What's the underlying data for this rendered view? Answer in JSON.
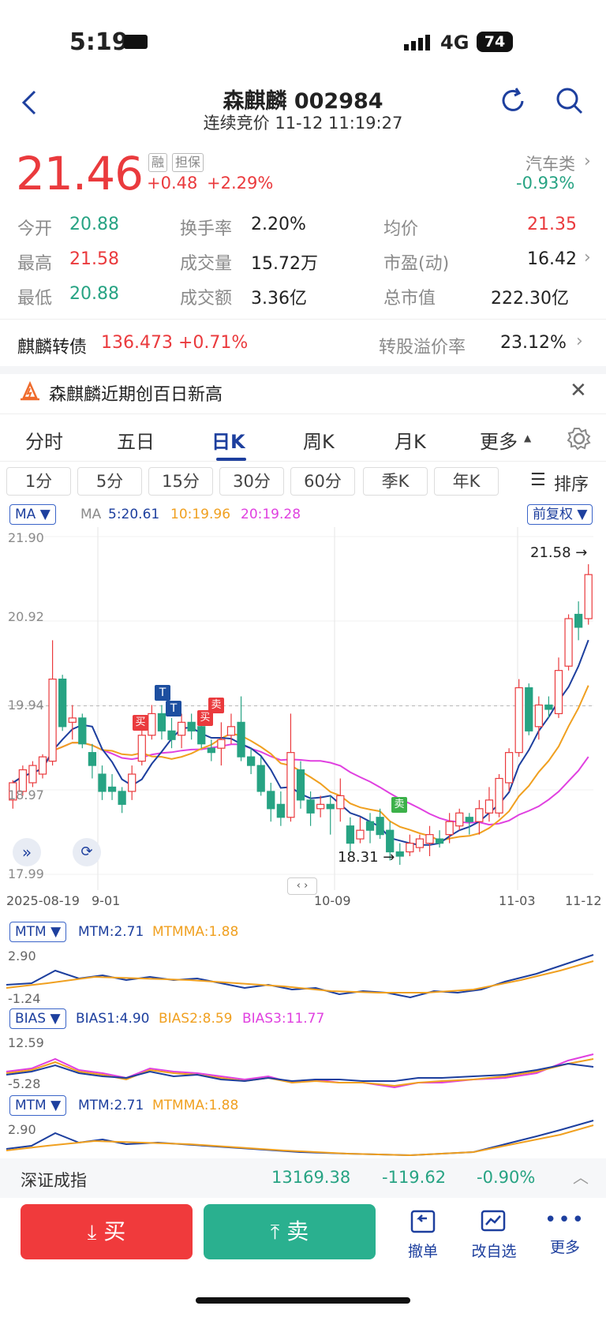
{
  "status": {
    "time": "5:19",
    "network": "4G",
    "battery": "74"
  },
  "header": {
    "title": "森麒麟 002984",
    "subtitle": "连续竞价 11-12 11:19:27"
  },
  "quote": {
    "price": "21.46",
    "tag1": "融",
    "tag2": "担保",
    "change": "+0.48",
    "change_pct": "+2.29%",
    "sector": "汽车类",
    "sector_pct": "-0.93%"
  },
  "stats": [
    [
      {
        "label": "今开",
        "value": "20.88",
        "color": "green"
      },
      {
        "label": "换手率",
        "value": "2.20%",
        "color": "dark"
      },
      {
        "label": "均价",
        "value": "21.35",
        "color": "red"
      }
    ],
    [
      {
        "label": "最高",
        "value": "21.58",
        "color": "red"
      },
      {
        "label": "成交量",
        "value": "15.72万",
        "color": "dark"
      },
      {
        "label": "市盈(动)",
        "value": "16.42",
        "color": "dark"
      }
    ],
    [
      {
        "label": "最低",
        "value": "20.88",
        "color": "green"
      },
      {
        "label": "成交额",
        "value": "3.36亿",
        "color": "dark"
      },
      {
        "label": "总市值",
        "value": "222.30亿",
        "color": "dark"
      }
    ]
  ],
  "bond": {
    "name": "麒麟转债",
    "value": "136.473 +0.71%",
    "premium_label": "转股溢价率",
    "premium": "23.12%"
  },
  "notice": {
    "text": "森麒麟近期创百日新高"
  },
  "tabs": [
    "分时",
    "五日",
    "日K",
    "周K",
    "月K",
    "更多"
  ],
  "active_tab": "日K",
  "periods": [
    "1分",
    "5分",
    "15分",
    "30分",
    "60分",
    "季K",
    "年K"
  ],
  "sort_label": "排序",
  "ma": {
    "chip": "MA",
    "label": "MA",
    "ma5": "5:20.61",
    "ma10": "10:19.96",
    "ma20": "20:19.28",
    "adjust": "前复权"
  },
  "price_axis": [
    "21.90",
    "20.92",
    "19.94",
    "18.97",
    "17.99"
  ],
  "date_axis": [
    "2025-08-19",
    "9-01",
    "10-09",
    "11-03",
    "11-12"
  ],
  "markers": {
    "high": "21.58",
    "low": "18.31",
    "buy": "买",
    "sell": "卖",
    "t": "T"
  },
  "mtm": {
    "chip": "MTM",
    "mtm": "MTM:2.71",
    "mtmma": "MTMMA:1.88",
    "top": "2.90",
    "bottom": "-1.24"
  },
  "bias": {
    "chip": "BIAS",
    "b1": "BIAS1:4.90",
    "b2": "BIAS2:8.59",
    "b3": "BIAS3:11.77",
    "top": "12.59",
    "bottom": "-5.28"
  },
  "mtm2": {
    "chip": "MTM",
    "mtm": "MTM:2.71",
    "mtmma": "MTMMA:1.88",
    "top": "2.90"
  },
  "index": {
    "name": "深证成指",
    "value": "13169.38",
    "change": "-119.62",
    "pct": "-0.90%"
  },
  "actions": {
    "buy": "买",
    "sell": "卖",
    "cancel": "撤单",
    "edit": "改自选",
    "more": "更多"
  },
  "chart_data": {
    "type": "candlestick",
    "ylim": [
      17.99,
      21.9
    ],
    "candles": [
      [
        18.85,
        19.05,
        18.75,
        19.08
      ],
      [
        18.95,
        19.2,
        18.9,
        19.25
      ],
      [
        19.05,
        19.25,
        19.0,
        19.3
      ],
      [
        19.15,
        19.35,
        19.1,
        19.38
      ],
      [
        19.3,
        20.25,
        19.25,
        20.7
      ],
      [
        20.25,
        19.7,
        19.65,
        20.3
      ],
      [
        19.75,
        19.8,
        19.55,
        19.95
      ],
      [
        19.8,
        19.5,
        19.45,
        19.85
      ],
      [
        19.4,
        19.25,
        19.1,
        19.5
      ],
      [
        19.15,
        18.95,
        18.85,
        19.25
      ],
      [
        19.0,
        18.95,
        18.85,
        19.15
      ],
      [
        18.95,
        18.8,
        18.7,
        19.0
      ],
      [
        18.95,
        19.15,
        18.85,
        19.25
      ],
      [
        19.3,
        19.6,
        19.25,
        19.75
      ],
      [
        19.6,
        19.85,
        19.55,
        19.95
      ],
      [
        19.85,
        19.65,
        19.55,
        19.95
      ],
      [
        19.65,
        19.55,
        19.45,
        19.8
      ],
      [
        19.6,
        19.75,
        19.45,
        19.85
      ],
      [
        19.75,
        19.65,
        19.55,
        19.85
      ],
      [
        19.7,
        19.5,
        19.45,
        19.8
      ],
      [
        19.45,
        19.4,
        19.3,
        19.55
      ],
      [
        19.45,
        19.55,
        19.25,
        19.75
      ],
      [
        19.6,
        19.7,
        19.5,
        19.85
      ],
      [
        19.75,
        19.35,
        19.3,
        20.05
      ],
      [
        19.35,
        19.25,
        19.15,
        19.45
      ],
      [
        19.25,
        18.95,
        18.9,
        19.35
      ],
      [
        18.95,
        18.75,
        18.6,
        19.05
      ],
      [
        18.8,
        18.65,
        18.55,
        18.95
      ],
      [
        18.65,
        19.4,
        18.6,
        19.85
      ],
      [
        19.2,
        18.85,
        18.75,
        19.3
      ],
      [
        18.85,
        18.7,
        18.55,
        18.95
      ],
      [
        18.75,
        18.8,
        18.65,
        18.9
      ],
      [
        18.8,
        18.75,
        18.45,
        18.9
      ],
      [
        18.75,
        18.9,
        18.6,
        19.1
      ],
      [
        18.55,
        18.35,
        18.25,
        18.65
      ],
      [
        18.4,
        18.5,
        18.35,
        18.65
      ],
      [
        18.6,
        18.5,
        18.35,
        18.7
      ],
      [
        18.65,
        18.45,
        18.4,
        18.75
      ],
      [
        18.5,
        18.25,
        18.15,
        18.6
      ],
      [
        18.25,
        18.2,
        18.1,
        18.35
      ],
      [
        18.25,
        18.35,
        18.2,
        18.45
      ],
      [
        18.3,
        18.4,
        18.25,
        18.45
      ],
      [
        18.35,
        18.45,
        18.2,
        18.55
      ],
      [
        18.4,
        18.35,
        18.3,
        18.5
      ],
      [
        18.45,
        18.6,
        18.35,
        18.7
      ],
      [
        18.55,
        18.7,
        18.5,
        18.75
      ],
      [
        18.65,
        18.6,
        18.45,
        18.7
      ],
      [
        18.6,
        18.75,
        18.45,
        18.85
      ],
      [
        18.7,
        18.85,
        18.6,
        19.0
      ],
      [
        18.7,
        19.1,
        18.65,
        19.15
      ],
      [
        19.05,
        19.4,
        18.95,
        19.45
      ],
      [
        19.4,
        20.15,
        19.35,
        20.25
      ],
      [
        20.15,
        19.65,
        19.6,
        20.2
      ],
      [
        19.7,
        19.95,
        19.55,
        20.05
      ],
      [
        19.95,
        19.9,
        19.8,
        20.05
      ],
      [
        19.85,
        20.35,
        19.8,
        20.5
      ],
      [
        20.4,
        20.95,
        20.35,
        21.0
      ],
      [
        21.0,
        20.85,
        20.7,
        21.15
      ],
      [
        20.95,
        21.46,
        20.88,
        21.58
      ]
    ]
  }
}
